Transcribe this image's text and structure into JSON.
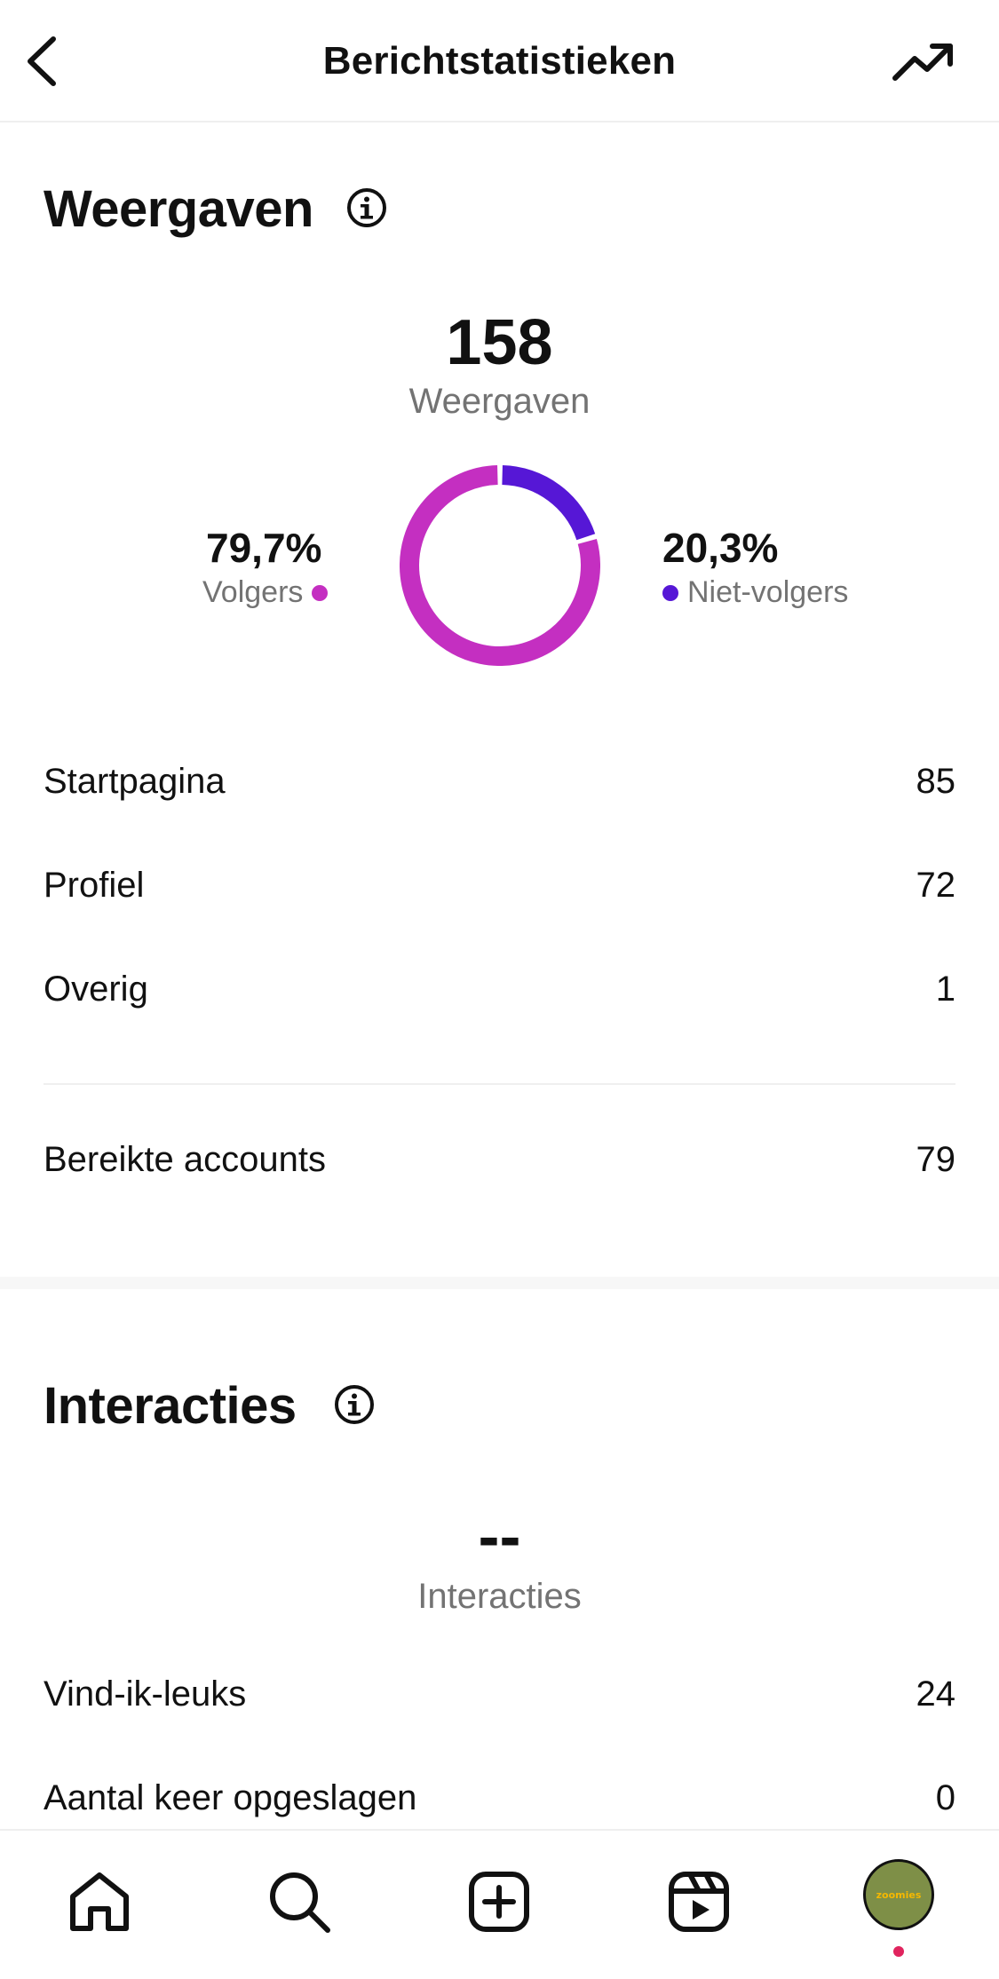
{
  "header": {
    "title": "Berichtstatistieken",
    "back_icon": "chevron-left-icon",
    "trend_icon": "trending-up-icon"
  },
  "views": {
    "title": "Weergaven",
    "total": "158",
    "total_label": "Weergaven",
    "followers_pct": "79,7%",
    "followers_label": "Volgers",
    "non_followers_pct": "20,3%",
    "non_followers_label": "Niet-volgers",
    "donut": {
      "followers_fraction": 0.797,
      "non_followers_fraction": 0.203
    },
    "colors": {
      "followers": "#c42fc1",
      "non_followers": "#5617d6"
    },
    "breakdown": [
      {
        "label": "Startpagina",
        "value": "85"
      },
      {
        "label": "Profiel",
        "value": "72"
      },
      {
        "label": "Overig",
        "value": "1"
      }
    ],
    "reached_label": "Bereikte accounts",
    "reached_value": "79"
  },
  "interactions": {
    "title": "Interacties",
    "total": "--",
    "total_label": "Interacties",
    "rows": [
      {
        "label": "Vind-ik-leuks",
        "value": "24"
      },
      {
        "label": "Aantal keer opgeslagen",
        "value": "0"
      }
    ]
  },
  "nav": {
    "items": [
      "home-icon",
      "search-icon",
      "create-icon",
      "reels-icon",
      "profile-avatar"
    ],
    "avatar_text": "zoomies"
  }
}
